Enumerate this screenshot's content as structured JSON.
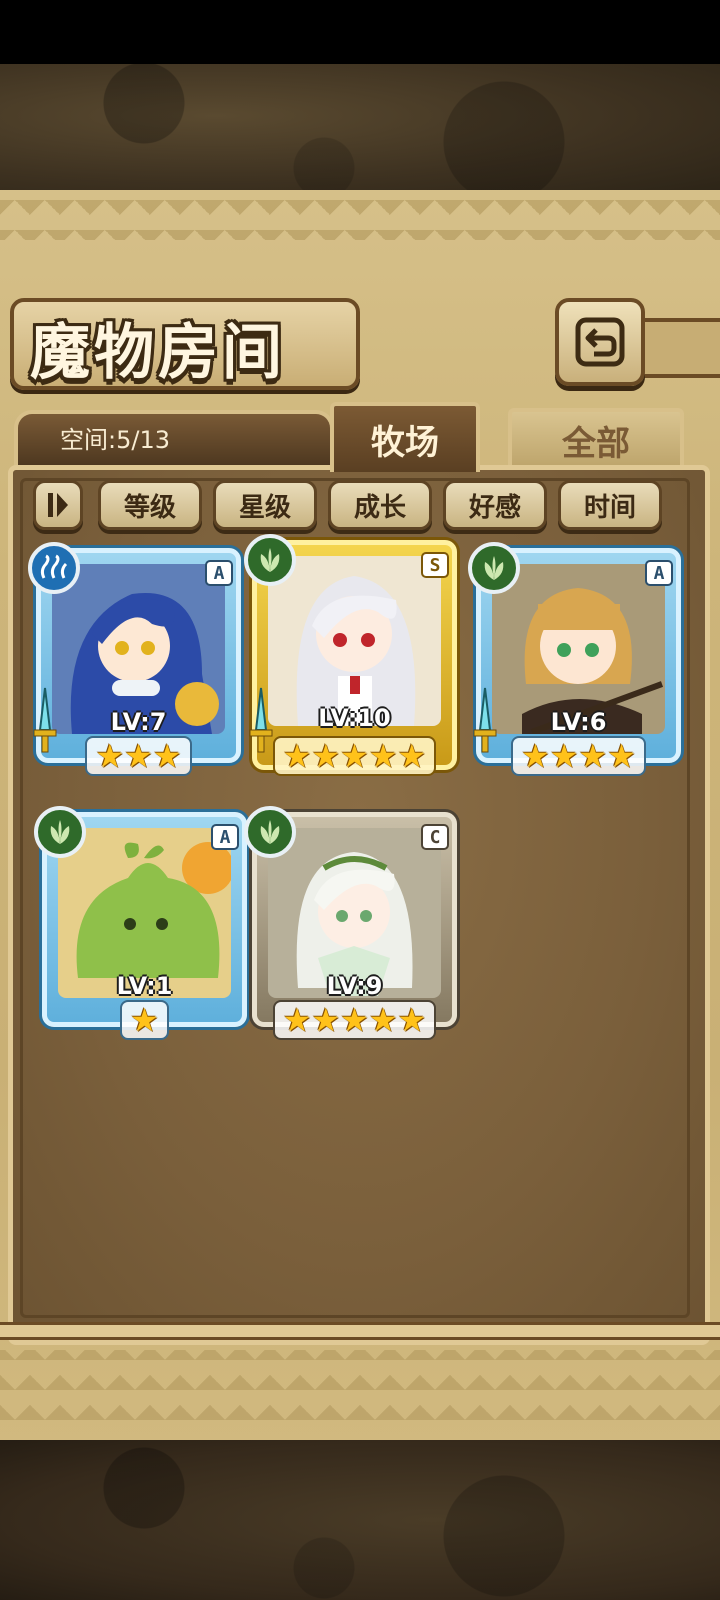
{
  "title": "魔物房间",
  "space": {
    "label": "空间:5/13"
  },
  "tabs": {
    "ranch": "牧场",
    "all": "全部"
  },
  "sort_buttons": [
    "等级",
    "星级",
    "成长",
    "好感",
    "时间"
  ],
  "cards": [
    {
      "grade": "A",
      "element": "water",
      "level": "LV:7",
      "stars": 3,
      "frame": "a"
    },
    {
      "grade": "S",
      "element": "leaf",
      "level": "LV:10",
      "stars": 5,
      "frame": "s"
    },
    {
      "grade": "A",
      "element": "leaf",
      "level": "LV:6",
      "stars": 4,
      "frame": "a"
    },
    {
      "grade": "A",
      "element": "leaf",
      "level": "LV:1",
      "stars": 1,
      "frame": "a"
    },
    {
      "grade": "C",
      "element": "leaf",
      "level": "LV:9",
      "stars": 5,
      "frame": "c"
    }
  ],
  "colors": {
    "panel": "#cdb57a",
    "content": "#7a5f3b",
    "tab_active": "#5a3f22",
    "star": "#ffc21a"
  }
}
